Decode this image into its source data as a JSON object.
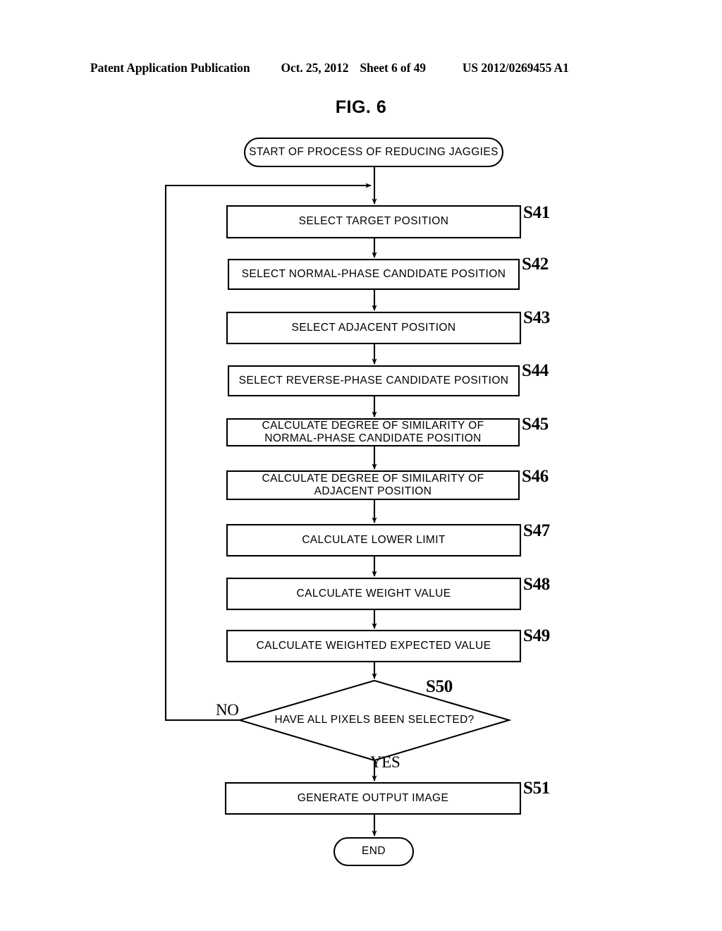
{
  "header": {
    "publication": "Patent Application Publication",
    "date": "Oct. 25, 2012",
    "sheet": "Sheet 6 of 49",
    "number": "US 2012/0269455 A1"
  },
  "figure": {
    "title": "FIG. 6"
  },
  "flowchart": {
    "start": {
      "label": "START OF PROCESS OF REDUCING JAGGIES"
    },
    "end": {
      "label": "END"
    },
    "steps": [
      {
        "id": "S41",
        "label": "SELECT TARGET POSITION",
        "lines": [
          "SELECT TARGET POSITION"
        ]
      },
      {
        "id": "S42",
        "label": "SELECT NORMAL-PHASE CANDIDATE POSITION",
        "lines": [
          "SELECT NORMAL-PHASE CANDIDATE POSITION"
        ]
      },
      {
        "id": "S43",
        "label": "SELECT ADJACENT POSITION",
        "lines": [
          "SELECT ADJACENT POSITION"
        ]
      },
      {
        "id": "S44",
        "label": "SELECT REVERSE-PHASE CANDIDATE POSITION",
        "lines": [
          "SELECT REVERSE-PHASE CANDIDATE POSITION"
        ]
      },
      {
        "id": "S45",
        "label": "CALCULATE DEGREE OF SIMILARITY OF NORMAL-PHASE CANDIDATE POSITION",
        "lines": [
          "CALCULATE DEGREE OF SIMILARITY OF",
          "NORMAL-PHASE CANDIDATE POSITION"
        ]
      },
      {
        "id": "S46",
        "label": "CALCULATE DEGREE OF SIMILARITY OF ADJACENT POSITION",
        "lines": [
          "CALCULATE DEGREE OF SIMILARITY OF",
          "ADJACENT POSITION"
        ]
      },
      {
        "id": "S47",
        "label": "CALCULATE LOWER LIMIT",
        "lines": [
          "CALCULATE LOWER LIMIT"
        ]
      },
      {
        "id": "S48",
        "label": "CALCULATE WEIGHT VALUE",
        "lines": [
          "CALCULATE WEIGHT VALUE"
        ]
      },
      {
        "id": "S49",
        "label": "CALCULATE WEIGHTED EXPECTED VALUE",
        "lines": [
          "CALCULATE WEIGHTED EXPECTED VALUE"
        ]
      },
      {
        "id": "S51",
        "label": "GENERATE OUTPUT IMAGE",
        "lines": [
          "GENERATE OUTPUT IMAGE"
        ]
      }
    ],
    "decision": {
      "id": "S50",
      "label": "HAVE ALL PIXELS BEEN SELECTED?",
      "no_label": "NO",
      "yes_label": "YES"
    },
    "colors": {
      "stroke": "#000000",
      "fill": "#ffffff"
    }
  }
}
